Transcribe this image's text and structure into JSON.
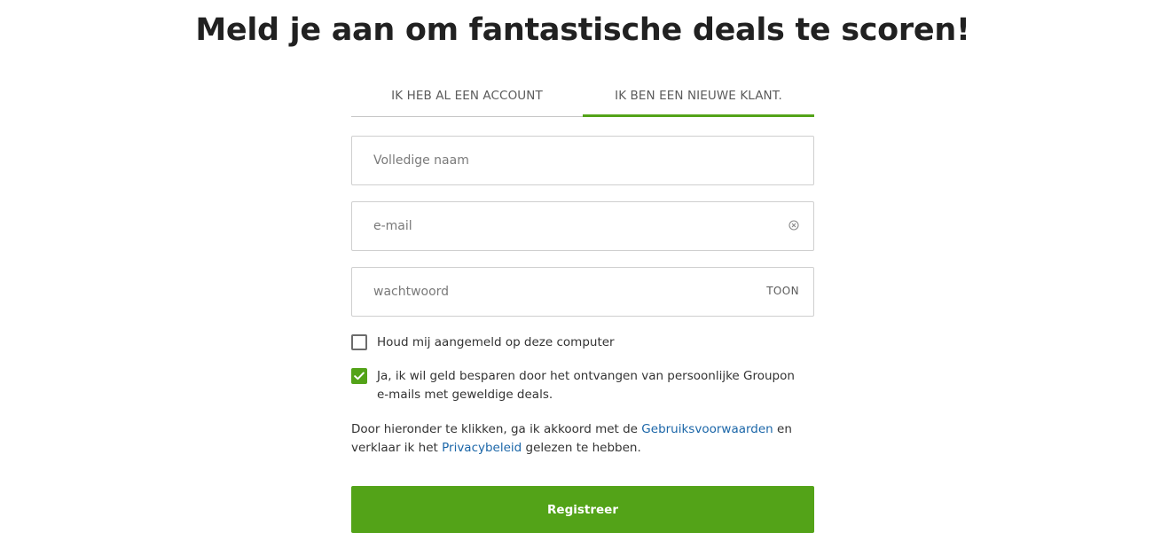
{
  "headline": "Meld je aan om fantastische deals te scoren!",
  "tabs": {
    "login": "IK HEB AL EEN ACCOUNT",
    "register": "IK BEN EEN NIEUWE KLANT.",
    "active": "register"
  },
  "fields": {
    "name": {
      "placeholder": "Volledige naam",
      "value": ""
    },
    "email": {
      "placeholder": "e-mail",
      "value": "",
      "clear_icon": "clear-circle-icon"
    },
    "password": {
      "placeholder": "wachtwoord",
      "value": "",
      "toggle_label": "TOON"
    }
  },
  "checkboxes": {
    "remember": {
      "label": "Houd mij aangemeld op deze computer",
      "checked": false
    },
    "emails": {
      "label": "Ja, ik wil geld besparen door het ontvangen van persoonlijke Groupon e-mails met geweldige deals.",
      "checked": true
    }
  },
  "terms": {
    "text_before": "Door hieronder te klikken, ga ik akkoord met de ",
    "terms_link": "Gebruiksvoorwaarden",
    "text_middle": " en verklaar ik het ",
    "privacy_link": "Privacybeleid",
    "text_after": " gelezen te hebben."
  },
  "register_button": "Registreer",
  "colors": {
    "accent": "#53a318",
    "link": "#1b66a8",
    "heading": "#212121"
  }
}
